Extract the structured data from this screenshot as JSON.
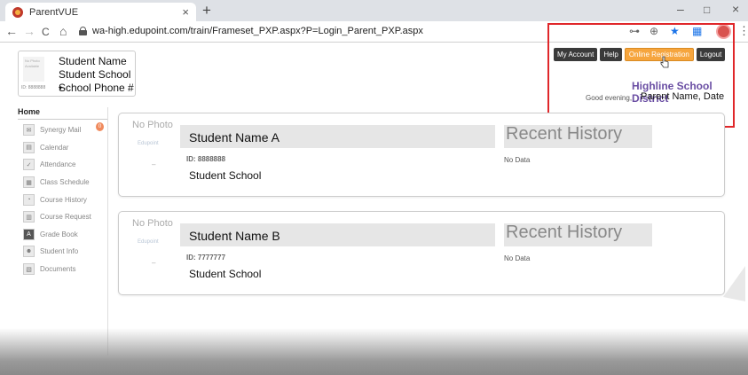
{
  "browser": {
    "tab_title": "ParentVUE",
    "tab_close": "×",
    "new_tab": "+",
    "url": "wa-high.edupoint.com/train/Frameset_PXP.aspx?P=Login_Parent_PXP.aspx",
    "nav": {
      "back": "←",
      "forward": "→",
      "reload": "C",
      "home": "⌂"
    },
    "window": {
      "minimize": "–",
      "maximize": "□",
      "close": "×"
    },
    "extensions": {
      "key": "⊶",
      "zoom": "⊕",
      "star": "★",
      "grid": "▦",
      "menu": "⋮"
    }
  },
  "student_card": {
    "photo_text": "No Photo Available",
    "id_text": "ID: 8888888",
    "name": "Student Name",
    "school": "Student School",
    "school_dropdown": "▾",
    "phone": "School Phone #"
  },
  "header": {
    "buttons": {
      "my_account": "My Account",
      "help": "Help",
      "online_registration": "Online Registration",
      "logout": "Logout"
    },
    "district": "Highline School District",
    "greeting": "Good evening,",
    "parent": "Parent Name, Date"
  },
  "sidebar": {
    "home": "Home",
    "items": [
      {
        "label": "Synergy Mail",
        "icon": "mail-icon",
        "glyph": "✉",
        "badge": "0"
      },
      {
        "label": "Calendar",
        "icon": "calendar-icon",
        "glyph": "▤"
      },
      {
        "label": "Attendance",
        "icon": "attendance-icon",
        "glyph": "✓"
      },
      {
        "label": "Class Schedule",
        "icon": "schedule-icon",
        "glyph": "▦"
      },
      {
        "label": "Course History",
        "icon": "history-icon",
        "glyph": "◔"
      },
      {
        "label": "Course Request",
        "icon": "request-icon",
        "glyph": "▥"
      },
      {
        "label": "Grade Book",
        "icon": "gradebook-icon",
        "glyph": "A"
      },
      {
        "label": "Student Info",
        "icon": "student-info-icon",
        "glyph": "☻"
      },
      {
        "label": "Documents",
        "icon": "documents-icon",
        "glyph": "▧"
      }
    ]
  },
  "students": [
    {
      "no_photo": "No Photo",
      "logo": "Edupoint",
      "dash": "–",
      "name": "Student Name A",
      "id": "ID: 8888888",
      "school": "Student School",
      "history_title": "Recent History",
      "history_value": "No Data"
    },
    {
      "no_photo": "No Photo",
      "logo": "Edupoint",
      "dash": "–",
      "name": "Student Name B",
      "id": "ID: 7777777",
      "school": "Student School",
      "history_title": "Recent History",
      "history_value": "No Data"
    }
  ]
}
